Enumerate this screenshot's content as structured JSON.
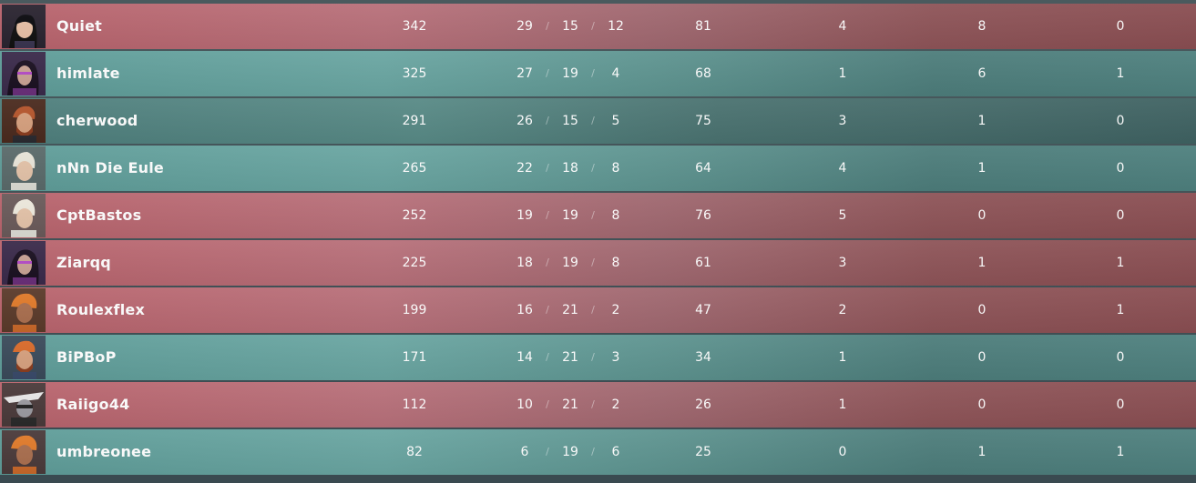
{
  "colors": {
    "red_row": "#b9636c",
    "teal_row": "#5e9c98",
    "text": "#ffffff"
  },
  "players": [
    {
      "name": "Quiet",
      "acs": "342",
      "k": "29",
      "d": "15",
      "a": "12",
      "econ": "81",
      "fb": "4",
      "plants": "8",
      "defuses": "0",
      "team": "red",
      "agent_icon": "agent-portrait-icon"
    },
    {
      "name": "himlate",
      "acs": "325",
      "k": "27",
      "d": "19",
      "a": "4",
      "econ": "68",
      "fb": "1",
      "plants": "6",
      "defuses": "1",
      "team": "teal",
      "agent_icon": "agent-portrait-icon"
    },
    {
      "name": "cherwood",
      "acs": "291",
      "k": "26",
      "d": "15",
      "a": "5",
      "econ": "75",
      "fb": "3",
      "plants": "1",
      "defuses": "0",
      "team": "teal",
      "agent_icon": "agent-portrait-icon"
    },
    {
      "name": "nNn Die Eule",
      "acs": "265",
      "k": "22",
      "d": "18",
      "a": "8",
      "econ": "64",
      "fb": "4",
      "plants": "1",
      "defuses": "0",
      "team": "teal",
      "agent_icon": "agent-portrait-icon"
    },
    {
      "name": "CptBastos",
      "acs": "252",
      "k": "19",
      "d": "19",
      "a": "8",
      "econ": "76",
      "fb": "5",
      "plants": "0",
      "defuses": "0",
      "team": "red",
      "agent_icon": "agent-portrait-icon"
    },
    {
      "name": "Ziarqq",
      "acs": "225",
      "k": "18",
      "d": "19",
      "a": "8",
      "econ": "61",
      "fb": "3",
      "plants": "1",
      "defuses": "1",
      "team": "red",
      "agent_icon": "agent-portrait-icon"
    },
    {
      "name": "Roulexflex",
      "acs": "199",
      "k": "16",
      "d": "21",
      "a": "2",
      "econ": "47",
      "fb": "2",
      "plants": "0",
      "defuses": "1",
      "team": "red",
      "agent_icon": "agent-portrait-icon"
    },
    {
      "name": "BiPBoP",
      "acs": "171",
      "k": "14",
      "d": "21",
      "a": "3",
      "econ": "34",
      "fb": "1",
      "plants": "0",
      "defuses": "0",
      "team": "teal",
      "agent_icon": "agent-portrait-icon"
    },
    {
      "name": "Raiigo44",
      "acs": "112",
      "k": "10",
      "d": "21",
      "a": "2",
      "econ": "26",
      "fb": "1",
      "plants": "0",
      "defuses": "0",
      "team": "red",
      "agent_icon": "agent-portrait-icon"
    },
    {
      "name": "umbreonee",
      "acs": "82",
      "k": "6",
      "d": "19",
      "a": "6",
      "econ": "25",
      "fb": "0",
      "plants": "1",
      "defuses": "1",
      "team": "teal",
      "agent_icon": "agent-portrait-icon"
    }
  ],
  "separator": "/"
}
